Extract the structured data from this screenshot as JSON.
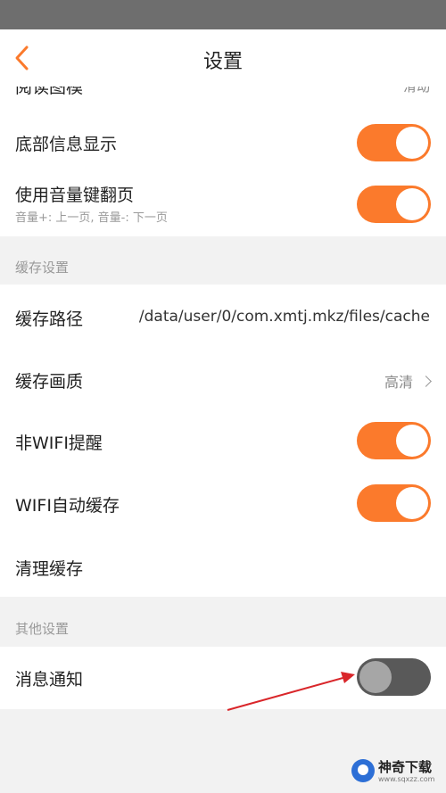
{
  "header": {
    "title": "设置"
  },
  "partial_row": {
    "label": "阅读图模",
    "value": "滑动"
  },
  "section1": {
    "rows": [
      {
        "label": "底部信息显示",
        "toggle": "on"
      },
      {
        "label": "使用音量键翻页",
        "sub": "音量+: 上一页, 音量-: 下一页",
        "toggle": "on"
      }
    ]
  },
  "cache_section": {
    "header": "缓存设置",
    "path_label": "缓存路径",
    "path_value": "/data/user/0/com.xmtj.mkz/files/cache",
    "quality_label": "缓存画质",
    "quality_value": "高清",
    "wifi_remind_label": "非WIFI提醒",
    "wifi_remind_toggle": "on",
    "wifi_auto_label": "WIFI自动缓存",
    "wifi_auto_toggle": "on",
    "clear_label": "清理缓存"
  },
  "other_section": {
    "header": "其他设置",
    "notify_label": "消息通知",
    "notify_toggle": "off"
  },
  "watermark": {
    "name": "神奇下载",
    "site": "www.sqxzz.com"
  },
  "colors": {
    "accent": "#fb7a2c",
    "toggle_off": "#595959",
    "annotation_arrow": "#d9262a"
  },
  "icons": {
    "back": "chevron-left-icon",
    "more": "chevron-right-icon"
  }
}
